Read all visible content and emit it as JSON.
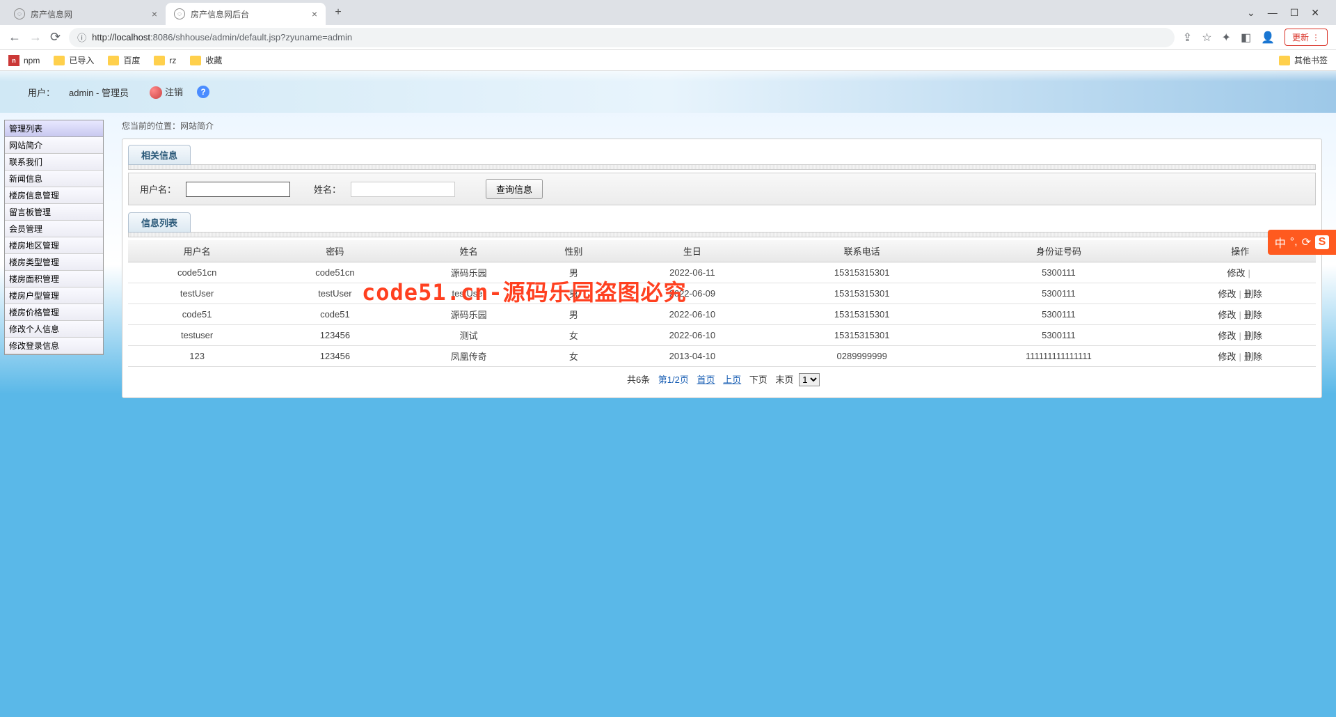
{
  "browser": {
    "tabs": [
      {
        "title": "房产信息网",
        "active": false
      },
      {
        "title": "房产信息网后台",
        "active": true
      }
    ],
    "url_host": "localhost",
    "url_port": ":8086",
    "url_path": "/shhouse/admin/default.jsp?zyuname=admin",
    "update_label": "更新",
    "bookmarks": [
      "npm",
      "已导入",
      "百度",
      "rz",
      "收藏"
    ],
    "other_bookmarks": "其他书签",
    "window": {
      "min": "—",
      "max": "☐",
      "close": "✕",
      "drop": "⌄"
    }
  },
  "header": {
    "user_label": "用户：",
    "user_value": "admin - 管理员",
    "logout": "注销"
  },
  "sidebar": {
    "title": "管理列表",
    "items": [
      "网站简介",
      "联系我们",
      "新闻信息",
      "楼房信息管理",
      "留言板管理",
      "会员管理",
      "楼房地区管理",
      "楼房类型管理",
      "楼房面积管理",
      "楼房户型管理",
      "楼房价格管理",
      "修改个人信息",
      "修改登录信息"
    ]
  },
  "breadcrumb": {
    "prefix": "您当前的位置：",
    "current": "网站简介"
  },
  "filter": {
    "section_title": "相关信息",
    "username_label": "用户名：",
    "name_label": "姓名：",
    "query_btn": "查询信息"
  },
  "table": {
    "section_title": "信息列表",
    "headers": [
      "用户名",
      "密码",
      "姓名",
      "性别",
      "生日",
      "联系电话",
      "身份证号码",
      "操作"
    ],
    "rows": [
      {
        "c": [
          "code51cn",
          "code51cn",
          "源码乐园",
          "男",
          "2022-06-11",
          "15315315301",
          "5300111"
        ],
        "edit": "修改",
        "del": ""
      },
      {
        "c": [
          "testUser",
          "testUser",
          "testUser",
          "男",
          "2022-06-09",
          "15315315301",
          "5300111"
        ],
        "edit": "修改",
        "del": "删除"
      },
      {
        "c": [
          "code51",
          "code51",
          "源码乐园",
          "男",
          "2022-06-10",
          "15315315301",
          "5300111"
        ],
        "edit": "修改",
        "del": "删除"
      },
      {
        "c": [
          "testuser",
          "123456",
          "测试",
          "女",
          "2022-06-10",
          "15315315301",
          "5300111"
        ],
        "edit": "修改",
        "del": "删除"
      },
      {
        "c": [
          "123",
          "123456",
          "凤凰传奇",
          "女",
          "2013-04-10",
          "0289999999",
          "111111111111111"
        ],
        "edit": "修改",
        "del": "删除"
      }
    ]
  },
  "pager": {
    "total": "共6条",
    "page": "第1/2页",
    "first": "首页",
    "prev": "上页",
    "next": "下页",
    "last": "末页",
    "select": "1"
  },
  "watermark": "code51.cn-源码乐园盗图必究",
  "ime": {
    "mode": "中",
    "punct": "°,",
    "half": "⟳"
  }
}
